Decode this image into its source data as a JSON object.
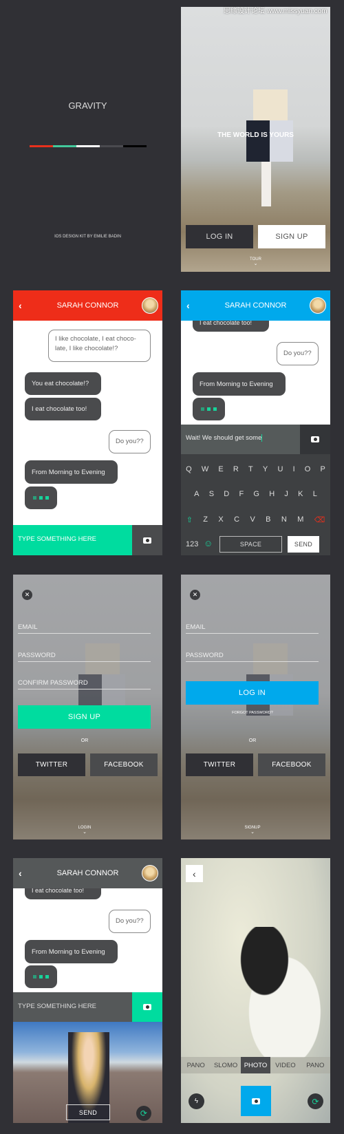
{
  "watermark": "思缘设计论坛 www.missyuan.com",
  "splash": {
    "title": "GRAVITY",
    "credits": "IOS DESIGN KIT BY EMILIE BADIN",
    "palette": [
      "#e8301c",
      "#43c99b",
      "#ffffff",
      "#4a4a4f",
      "#000000"
    ]
  },
  "welcome": {
    "tagline": "THE WORLD IS YOURS",
    "login": "LOG IN",
    "signup": "SIGN UP",
    "tour": "TOUR"
  },
  "chat1": {
    "header_color": "#ee2d19",
    "title": "SARAH CONNOR",
    "messages": [
      "I like chocolate, I eat choco-late, I like chocolate!?",
      "You eat chocolate!?",
      "I eat chocolate too!",
      "Do you??",
      "From Morning to Evening"
    ],
    "input_placeholder": "TYPE SOMETHING HERE",
    "input_color": "#00dc9f"
  },
  "chat2": {
    "header_color": "#00a9ec",
    "title": "SARAH CONNOR",
    "messages": [
      "I eat chocolate too!",
      "Do you??",
      "From Morning to Evening"
    ],
    "input_value": "Wait! We should get some",
    "keyboard": {
      "row1": [
        "Q",
        "W",
        "E",
        "R",
        "T",
        "Y",
        "U",
        "I",
        "O",
        "P"
      ],
      "row2": [
        "A",
        "S",
        "D",
        "F",
        "G",
        "H",
        "J",
        "K",
        "L"
      ],
      "row3": [
        "Z",
        "X",
        "C",
        "V",
        "B",
        "N",
        "M"
      ],
      "numbers": "123",
      "space": "SPACE",
      "send": "SEND"
    }
  },
  "signup_form": {
    "email": "EMAIL",
    "password": "PASSWORD",
    "confirm": "CONFIRM PASSWORD",
    "submit": "SIGN UP",
    "or": "OR",
    "twitter": "TWITTER",
    "facebook": "FACEBOOK",
    "footer": "LOGIN"
  },
  "login_form": {
    "email": "EMAIL",
    "password": "PASSWORD",
    "submit": "LOG IN",
    "forgot": "FORGOT PASSWORD?",
    "or": "OR",
    "twitter": "TWITTER",
    "facebook": "FACEBOOK",
    "footer": "SIGNUP"
  },
  "chat3": {
    "header_color": "#555859",
    "title": "SARAH CONNOR",
    "messages": [
      "I eat chocolate too!",
      "Do you??",
      "From Morning to Evening"
    ],
    "input_placeholder": "TYPE SOMETHING HERE",
    "send": "SEND"
  },
  "camera": {
    "modes": [
      "PANO",
      "SLOMO",
      "PHOTO",
      "VIDEO",
      "PANO"
    ],
    "selected_mode": "PHOTO",
    "shutter_color": "#00a9ec"
  }
}
